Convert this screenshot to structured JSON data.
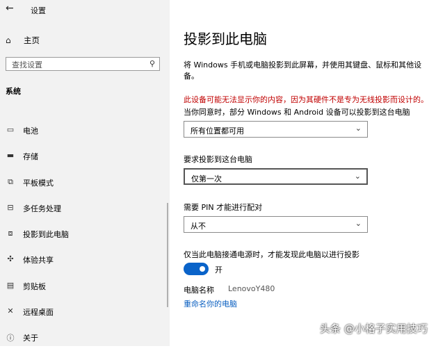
{
  "window": {
    "title": "设置"
  },
  "sidebar": {
    "home_label": "主页",
    "search_placeholder": "查找设置",
    "section_label": "系统",
    "items": [
      {
        "label": "电池",
        "icon": "battery-icon"
      },
      {
        "label": "存储",
        "icon": "storage-icon"
      },
      {
        "label": "平板模式",
        "icon": "tablet-mode-icon"
      },
      {
        "label": "多任务处理",
        "icon": "multitasking-icon"
      },
      {
        "label": "投影到此电脑",
        "icon": "project-icon",
        "active": true
      },
      {
        "label": "体验共享",
        "icon": "shared-experiences-icon"
      },
      {
        "label": "剪贴板",
        "icon": "clipboard-icon"
      },
      {
        "label": "远程桌面",
        "icon": "remote-desktop-icon"
      },
      {
        "label": "关于",
        "icon": "info-icon"
      }
    ]
  },
  "main": {
    "title": "投影到此电脑",
    "description": "将 Windows 手机或电脑投影到此屏幕，并使用其键盘、鼠标和其他设备。",
    "warning": "此设备可能无法显示你的内容，因为其硬件不是专为无线投影而设计的。",
    "availability_label": "当你同意时，部分 Windows 和 Android 设备可以投影到这台电脑",
    "availability_value": "所有位置都可用",
    "ask_label": "要求投影到这台电脑",
    "ask_value": "仅第一次",
    "pin_label": "需要 PIN 才能进行配对",
    "pin_value": "从不",
    "power_label": "仅当此电脑接通电源时，才能发现此电脑以进行投影",
    "toggle_state": "开",
    "pc_name_label": "电脑名称",
    "pc_name_value": "LenovoY480",
    "rename_link": "重命名你的电脑"
  },
  "watermark": {
    "text": "头条 @小格子实用技巧"
  },
  "colors": {
    "accent": "#0a63c9",
    "warning": "#c00000",
    "link": "#0a5fc0"
  }
}
